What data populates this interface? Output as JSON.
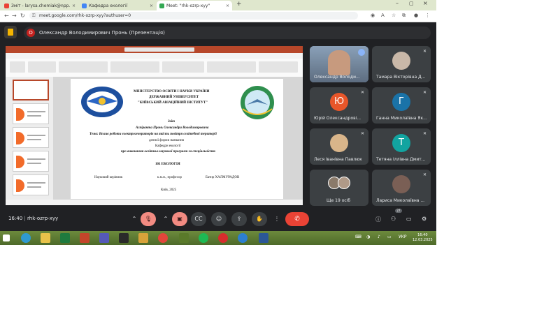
{
  "browser": {
    "tabs": [
      {
        "label": "Зміт - larysa.chemiak@npp.ka.in",
        "color": "#ea4335"
      },
      {
        "label": "Кафедра екології",
        "color": "#4285f4"
      },
      {
        "label": "Meet: \"rhk-ozrp-xyy\"",
        "color": "#34a853"
      }
    ],
    "url": "meet.google.com/rhk-ozrp-xyy?authuser=0"
  },
  "meet": {
    "presenter_initial": "О",
    "presenter_title": "Олександр Володимирович Пронь (Презентація)",
    "time": "16:40",
    "meeting_code": "rhk-ozrp-xyy",
    "participant_count": "27",
    "participants": [
      {
        "name": "Олександр Володи...",
        "type": "photo",
        "color": "#6b7c8f",
        "active": true
      },
      {
        "name": "Тамара Вікторівна Д...",
        "type": "photo",
        "color": "#c9b8a8"
      },
      {
        "name": "Юрій Олександрові...",
        "type": "initial",
        "initial": "Ю",
        "color": "#e8562a"
      },
      {
        "name": "Ганна Миколаївна Як...",
        "type": "initial",
        "initial": "Г",
        "color": "#1a73a8"
      },
      {
        "name": "Леся Іванівна Павлюк",
        "type": "photo",
        "color": "#d9b58a"
      },
      {
        "name": "Тетяна Іллівна Дмит...",
        "type": "initial",
        "initial": "Т",
        "color": "#12a4a0"
      },
      {
        "name": "Ще 19 осіб",
        "type": "more",
        "color": "#8a7a6a"
      },
      {
        "name": "Лариса Миколаївна ...",
        "type": "photo",
        "color": "#7a5f55"
      }
    ]
  },
  "slide": {
    "ministry": "МІНІСТЕРСТВО ОСВІТИ І НАУКИ УКРАЇНИ",
    "university1": "ДЕРЖАВНИЙ УНІВЕРСИТЕТ",
    "university2": "\"КИЇВСЬКИЙ АВІАЦІЙНИЙ ІНСТИТУТ\"",
    "report": "Звіт",
    "student": "Аспіранта Пронь Олександра Володимировича",
    "topic": "Тема: Вплив роботи електрогенераторів на якість повітря селітебної території",
    "form": "денної форми навчання",
    "dept": "Кафедри екології",
    "program": "про виконання освітньо-наукової програми за спеціальністю",
    "specialty": "101 ЕКОЛОГІЯ",
    "supervisor_label": "Науковий керівник",
    "degree": "к.м.н., професор",
    "supervisor": "Батир ХАЛМУРАДОВ",
    "city": "Київ, 2025"
  },
  "taskbar": {
    "lang": "УКР",
    "time": "16:40",
    "date": "12.03.2025"
  }
}
